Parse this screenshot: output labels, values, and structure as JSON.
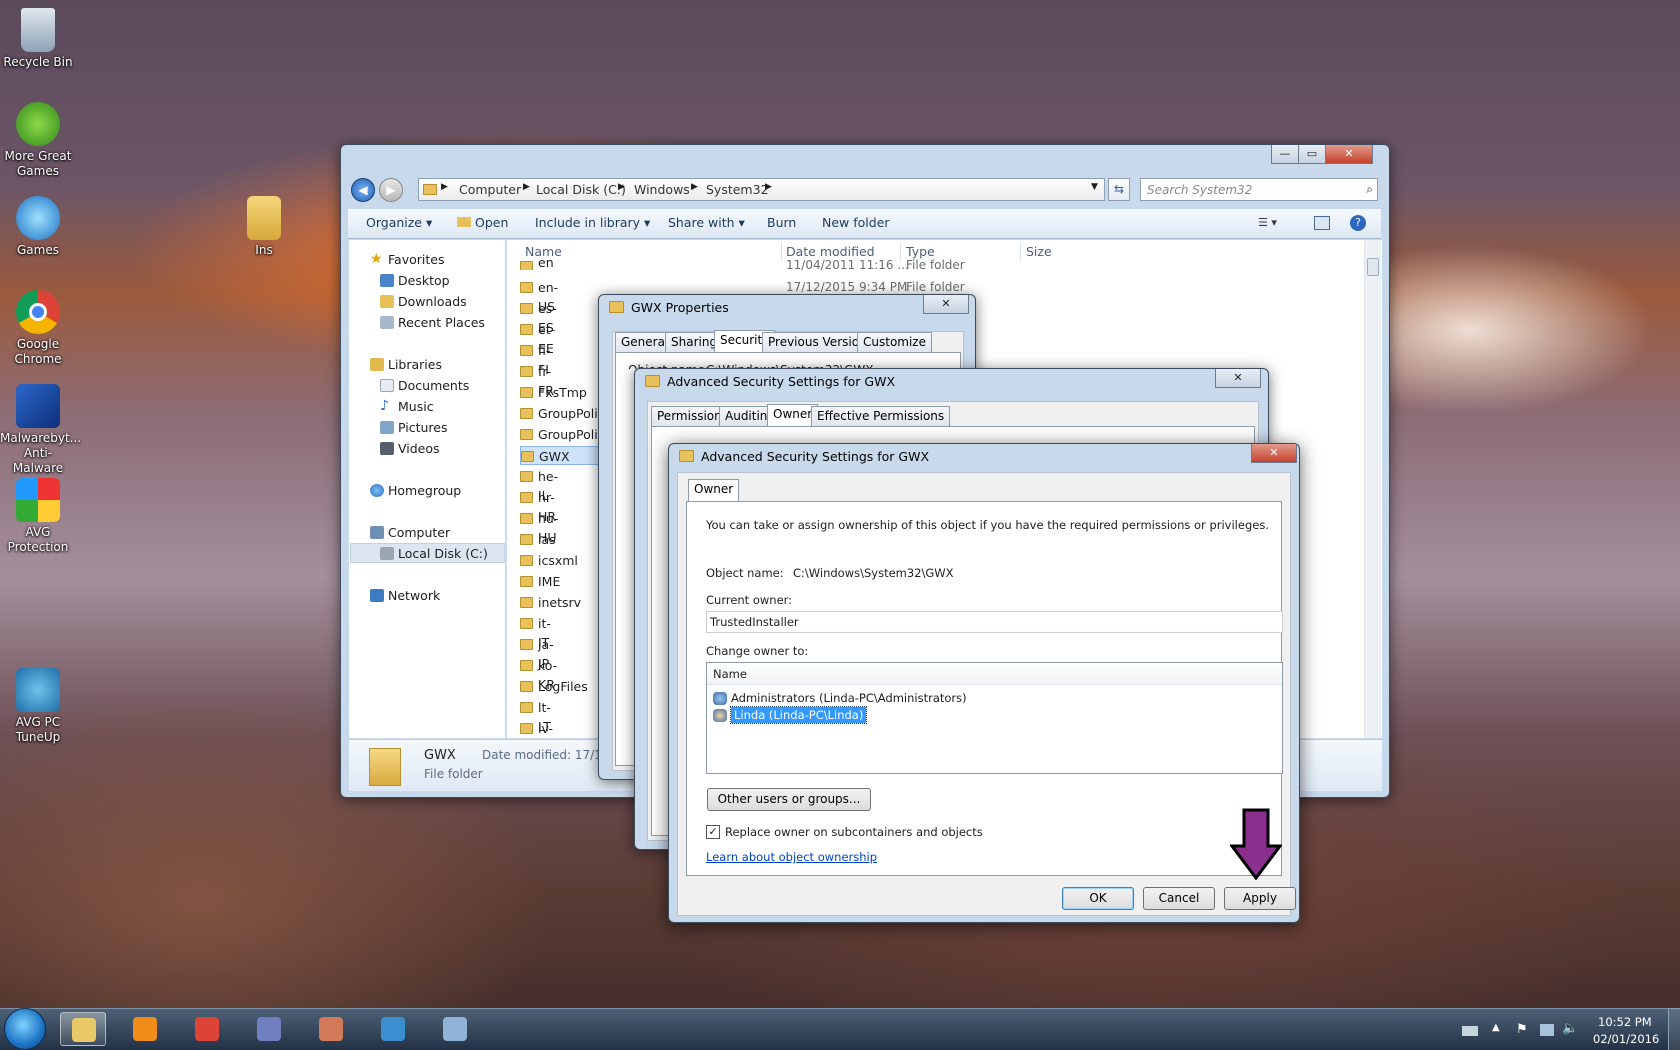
{
  "desktop": {
    "icons": [
      {
        "label": "Recycle Bin"
      },
      {
        "label": "More Great Games"
      },
      {
        "label": "Games"
      },
      {
        "label": "Ins"
      },
      {
        "label": "Google Chrome"
      },
      {
        "label": "Malwarebyt... Anti-Malware"
      },
      {
        "label": "AVG Protection"
      },
      {
        "label": "AVG PC TuneUp"
      }
    ]
  },
  "explorer": {
    "breadcrumb": [
      "Computer",
      "Local Disk (C:)",
      "Windows",
      "System32"
    ],
    "search_placeholder": "Search System32",
    "toolbar": [
      "Organize",
      "Open",
      "Include in library",
      "Share with",
      "Burn",
      "New folder"
    ],
    "nav": {
      "favorites": "Favorites",
      "fav_items": [
        "Desktop",
        "Downloads",
        "Recent Places"
      ],
      "libraries": "Libraries",
      "lib_items": [
        "Documents",
        "Music",
        "Pictures",
        "Videos"
      ],
      "homegroup": "Homegroup",
      "computer": "Computer",
      "computer_items": [
        "Local Disk (C:)"
      ],
      "network": "Network"
    },
    "columns": [
      "Name",
      "Date modified",
      "Type",
      "Size"
    ],
    "rows": [
      {
        "name": "en",
        "date": "11/04/2011 11:16 ...",
        "type": "File folder"
      },
      {
        "name": "en-US",
        "date": "17/12/2015 9:34 PM",
        "type": "File folder"
      },
      {
        "name": "es-ES"
      },
      {
        "name": "et-EE"
      },
      {
        "name": "fi-FI"
      },
      {
        "name": "fr-FR"
      },
      {
        "name": "FxsTmp"
      },
      {
        "name": "GroupPoli"
      },
      {
        "name": "GroupPoli"
      },
      {
        "name": "GWX"
      },
      {
        "name": "he-IL"
      },
      {
        "name": "hr-HR"
      },
      {
        "name": "hu-HU"
      },
      {
        "name": "ias"
      },
      {
        "name": "icsxml"
      },
      {
        "name": "IME"
      },
      {
        "name": "inetsrv"
      },
      {
        "name": "it-IT"
      },
      {
        "name": "ja-JP"
      },
      {
        "name": "ko-KR"
      },
      {
        "name": "LogFiles"
      },
      {
        "name": "lt-LT"
      },
      {
        "name": "lv-LV"
      }
    ],
    "details": {
      "name": "GWX",
      "type": "File folder",
      "date_label": "Date modified: 17/12/"
    }
  },
  "gwx_props": {
    "title": "GWX Properties",
    "tabs": [
      "General",
      "Sharing",
      "Security",
      "Previous Versions",
      "Customize"
    ],
    "obj_prefix": "Object name:",
    "obj_value": "C:\\Windows\\System32\\GWX"
  },
  "adv1": {
    "title": "Advanced Security Settings for GWX",
    "tabs": [
      "Permissions",
      "Auditing",
      "Owner",
      "Effective Permissions"
    ]
  },
  "adv2": {
    "title": "Advanced Security Settings for GWX",
    "tab": "Owner",
    "intro": "You can take or assign ownership of this object if you have the required permissions or privileges.",
    "object_name_label": "Object name:",
    "object_name_value": "C:\\Windows\\System32\\GWX",
    "current_owner_label": "Current owner:",
    "current_owner_value": "TrustedInstaller",
    "change_owner_label": "Change owner to:",
    "list_header": "Name",
    "owners": [
      "Administrators (Linda-PC\\Administrators)",
      "Linda (Linda-PC\\Linda)"
    ],
    "other_users_button": "Other users or groups...",
    "replace_checkbox_label": "Replace owner on subcontainers and objects",
    "learn_link": "Learn about object ownership",
    "ok": "OK",
    "cancel": "Cancel",
    "apply": "Apply"
  },
  "taskbar": {
    "time": "10:52 PM",
    "date": "02/01/2016"
  },
  "colors": {
    "accent_arrow": "#8b2f8f",
    "selection": "#3399ff"
  }
}
